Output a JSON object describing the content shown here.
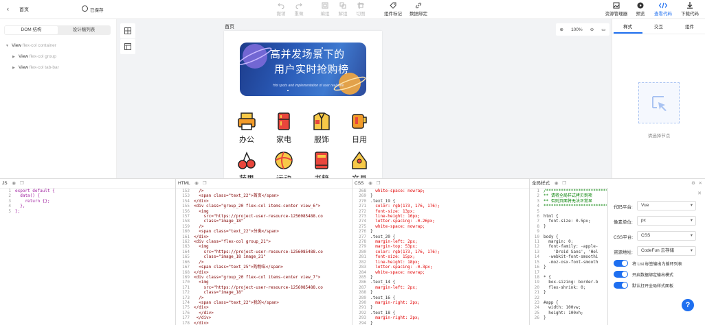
{
  "topbar": {
    "back_icon": "chevron-left-icon",
    "page_name": "首页",
    "saved": "已保存",
    "undo": "撤销",
    "redo": "重做",
    "group": "编组",
    "ungroup": "解组",
    "cut": "切图",
    "mark": "组件标记",
    "bind": "数据绑定",
    "assets": "资源管理器",
    "preview": "预览",
    "view_code": "查看代码",
    "download": "下载代码",
    "accent": "#1e6ff0"
  },
  "leftpanel": {
    "tab_dom": "DOM 结构",
    "tab_design": "设计稿列表",
    "tree": [
      {
        "tag": "View",
        "cls": "flex-col container"
      },
      {
        "tag": "View",
        "cls": "flex-col group"
      },
      {
        "tag": "View",
        "cls": "flex-col tab-bar"
      }
    ]
  },
  "canvas": {
    "page_label": "首页",
    "zoom": "100%",
    "banner_title_1": "高并发场景下的",
    "banner_title_2": "用户实时抢购榜",
    "banner_sub": "Hot spots and implementation of user real time",
    "categories": [
      {
        "label": "办公",
        "icon": "printer-icon"
      },
      {
        "label": "家电",
        "icon": "fridge-icon"
      },
      {
        "label": "服饰",
        "icon": "clothes-icon"
      },
      {
        "label": "日用",
        "icon": "mug-icon"
      }
    ],
    "categories2": [
      {
        "label": "蔬果",
        "icon": "cherry-icon"
      },
      {
        "label": "运动",
        "icon": "ball-icon"
      },
      {
        "label": "书籍",
        "icon": "book-icon"
      },
      {
        "label": "文具",
        "icon": "stationery-icon"
      }
    ]
  },
  "rightpanel": {
    "tab_style": "样式",
    "tab_interact": "交互",
    "tab_component": "组件",
    "hint": "请选择节点"
  },
  "panes": {
    "js": "JS",
    "html": "HTML",
    "css": "CSS",
    "global": "全局样式"
  },
  "settings": {
    "platform_label": "代码平台:",
    "platform": "Vue",
    "unit_label": "像素单位:",
    "unit": "px",
    "css_label": "CSS平台:",
    "css": "CSS",
    "res_label": "资源地址:",
    "res": "CodeFun 云存储",
    "t1": "将 List 标签输出为循环列表",
    "t2": "开启数据绑定输出模式",
    "t3": "默认打开全局样式面板"
  },
  "code": {
    "js": [
      {
        "n": "1",
        "t": "export default {"
      },
      {
        "n": "2",
        "t": "  data() {"
      },
      {
        "n": "3",
        "t": "    return {};"
      },
      {
        "n": "4",
        "t": "  },"
      },
      {
        "n": "5",
        "t": "};"
      }
    ],
    "html": [
      {
        "n": "152",
        "t": "  />"
      },
      {
        "n": "153",
        "t": "  <span class=\"text_22\">首页</span>"
      },
      {
        "n": "154",
        "t": "</div>"
      },
      {
        "n": "155",
        "t": "<div class=\"group_20 flex-col items-center view_6\">"
      },
      {
        "n": "156",
        "t": "  <img"
      },
      {
        "n": "157",
        "t": "    src=\"https://project-user-resource-1256085488.co"
      },
      {
        "n": "158",
        "t": "    class=\"image_18\""
      },
      {
        "n": "159",
        "t": "  />"
      },
      {
        "n": "160",
        "t": "  <span class=\"text_22\">分类</span>"
      },
      {
        "n": "161",
        "t": "</div>"
      },
      {
        "n": "162",
        "t": "<div class=\"flex-col group_21\">"
      },
      {
        "n": "163",
        "t": "  <img"
      },
      {
        "n": "164",
        "t": "    src=\"https://project-user-resource-1256085488.co"
      },
      {
        "n": "165",
        "t": "    class=\"image_18 image_21\""
      },
      {
        "n": "166",
        "t": "  />"
      },
      {
        "n": "167",
        "t": "  <span class=\"text_25\">购物车</span>"
      },
      {
        "n": "168",
        "t": "</div>"
      },
      {
        "n": "169",
        "t": "<div class=\"group_20 flex-col items-center view_7\">"
      },
      {
        "n": "170",
        "t": "  <img"
      },
      {
        "n": "171",
        "t": "    src=\"https://project-user-resource-1256085488.co"
      },
      {
        "n": "172",
        "t": "    class=\"image_18\""
      },
      {
        "n": "173",
        "t": "  />"
      },
      {
        "n": "174",
        "t": "  <span class=\"text_22\">我的</span>"
      },
      {
        "n": "175",
        "t": "</div>"
      },
      {
        "n": "176",
        "t": "  </div>"
      },
      {
        "n": "177",
        "t": " </div>"
      },
      {
        "n": "178",
        "t": "</div>"
      }
    ],
    "css": [
      {
        "n": "268",
        "t": "  white-space: nowrap;"
      },
      {
        "n": "269",
        "t": "}"
      },
      {
        "n": "270",
        "t": ".text_19 {"
      },
      {
        "n": "271",
        "t": "  color: rgb(173, 176, 176);"
      },
      {
        "n": "272",
        "t": "  font-size: 13px;"
      },
      {
        "n": "273",
        "t": "  line-height: 16px;"
      },
      {
        "n": "274",
        "t": "  letter-spacing: -0.26px;"
      },
      {
        "n": "275",
        "t": "  white-space: nowrap;"
      },
      {
        "n": "276",
        "t": "}"
      },
      {
        "n": "277",
        "t": ".text_20 {"
      },
      {
        "n": "278",
        "t": "  margin-left: 2px;"
      },
      {
        "n": "279",
        "t": "  margin-top: 53px;"
      },
      {
        "n": "280",
        "t": "  color: rgb(173, 176, 176);"
      },
      {
        "n": "281",
        "t": "  font-size: 15px;"
      },
      {
        "n": "282",
        "t": "  line-height: 18px;"
      },
      {
        "n": "283",
        "t": "  letter-spacing: -0.3px;"
      },
      {
        "n": "284",
        "t": "  white-space: nowrap;"
      },
      {
        "n": "285",
        "t": "}"
      },
      {
        "n": "286",
        "t": ".text_14 {"
      },
      {
        "n": "287",
        "t": "  margin-left: 2px;"
      },
      {
        "n": "288",
        "t": "}"
      },
      {
        "n": "289",
        "t": ".text_16 {"
      },
      {
        "n": "290",
        "t": "  margin-right: 2px;"
      },
      {
        "n": "291",
        "t": "}"
      },
      {
        "n": "292",
        "t": ".text_18 {"
      },
      {
        "n": "293",
        "t": "  margin-right: 2px;"
      },
      {
        "n": "294",
        "t": "}"
      }
    ],
    "global": [
      {
        "n": "1",
        "t": "/****************************"
      },
      {
        "n": "2",
        "t": "** 请将全局样式拷贝到项"
      },
      {
        "n": "3",
        "t": "** 否则页面将无法正常显"
      },
      {
        "n": "4",
        "t": "****************************"
      },
      {
        "n": "5",
        "t": ""
      },
      {
        "n": "6",
        "t": "html {"
      },
      {
        "n": "7",
        "t": "  font-size: 0.5px;"
      },
      {
        "n": "8",
        "t": "}"
      },
      {
        "n": "9",
        "t": ""
      },
      {
        "n": "10",
        "t": "body {"
      },
      {
        "n": "11",
        "t": "  margin: 0;"
      },
      {
        "n": "12",
        "t": "  font-family: -apple-"
      },
      {
        "n": "13",
        "t": "    'Droid Sans', 'Hel"
      },
      {
        "n": "14",
        "t": "  -webkit-font-smoothi"
      },
      {
        "n": "15",
        "t": "  -moz-osx-font-smooth"
      },
      {
        "n": "16",
        "t": "}"
      },
      {
        "n": "17",
        "t": ""
      },
      {
        "n": "18",
        "t": "* {"
      },
      {
        "n": "19",
        "t": "  box-sizing: border-b"
      },
      {
        "n": "20",
        "t": "  flex-shrink: 0;"
      },
      {
        "n": "21",
        "t": "}"
      },
      {
        "n": "22",
        "t": ""
      },
      {
        "n": "23",
        "t": "#app {"
      },
      {
        "n": "24",
        "t": "  width: 100vw;"
      },
      {
        "n": "25",
        "t": "  height: 100vh;"
      },
      {
        "n": "26",
        "t": "}"
      }
    ]
  }
}
